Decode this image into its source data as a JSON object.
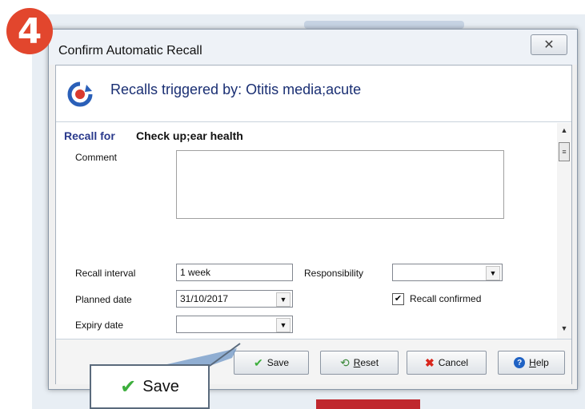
{
  "badge": "4",
  "window": {
    "title": "Confirm Automatic Recall",
    "close_glyph": "✕"
  },
  "header": {
    "text": "Recalls triggered by: Otitis media;acute"
  },
  "recall_for": {
    "label": "Recall for",
    "value": "Check up;ear health"
  },
  "form": {
    "comment_label": "Comment",
    "comment_value": "",
    "recall_interval_label": "Recall interval",
    "recall_interval_value": "1 week",
    "responsibility_label": "Responsibility",
    "responsibility_value": "",
    "planned_date_label": "Planned date",
    "planned_date_value": "31/10/2017",
    "recall_confirmed_label": "Recall confirmed",
    "recall_confirmed_checked": true,
    "expiry_date_label": "Expiry date",
    "expiry_date_value": ""
  },
  "buttons": {
    "save": "Save",
    "reset_first": "R",
    "reset_rest": "eset",
    "cancel": "Cancel",
    "help_first": "H",
    "help_rest": "elp"
  },
  "zoom": {
    "save": "Save"
  },
  "icons": {
    "save": "checkmark-icon",
    "reset": "reset-icon",
    "cancel": "cancel-x-icon",
    "help": "help-icon",
    "recall": "recall-icon"
  },
  "colors": {
    "badge": "#e2462d",
    "header_text": "#1a2f73",
    "check_green": "#3cae3c",
    "cancel_red": "#d9261c",
    "help_blue": "#1f62c4"
  }
}
